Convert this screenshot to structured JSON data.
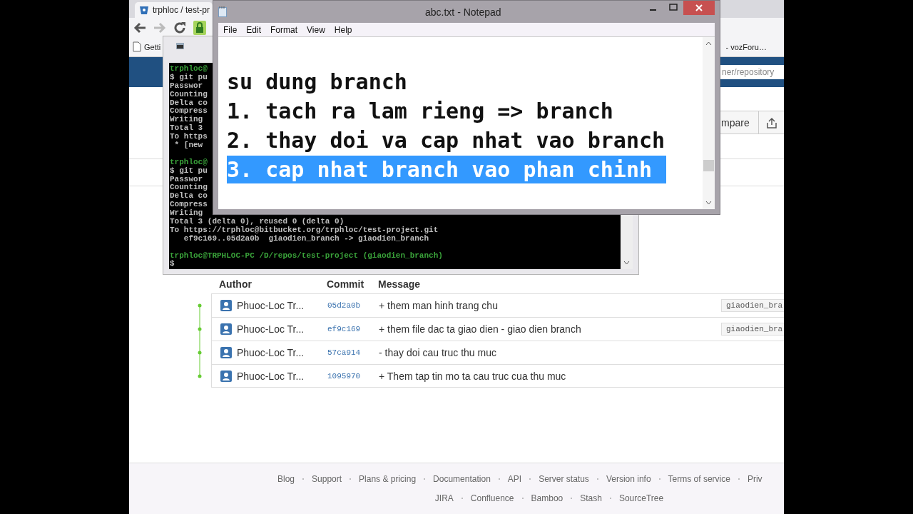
{
  "browser": {
    "tab": {
      "title": "trphloc / test-pr"
    },
    "bookmarks": [
      {
        "label": "Getti",
        "kind": "page"
      },
      {
        "label": "- vozForu…",
        "kind": "plain"
      }
    ],
    "search": {
      "placeholder": "ner/repository"
    },
    "toolbar": {
      "compare_label": "mpare"
    },
    "commits": {
      "columns": [
        "Author",
        "Commit",
        "Message"
      ],
      "rows": [
        {
          "author": "Phuoc-Loc Tr...",
          "hash": "05d2a0b",
          "message": "+ them man hinh trang chu",
          "tag": "giaodien_bra"
        },
        {
          "author": "Phuoc-Loc Tr...",
          "hash": "ef9c169",
          "message": "+ them file dac ta giao dien - giao dien branch",
          "tag": "giaodien_bra"
        },
        {
          "author": "Phuoc-Loc Tr...",
          "hash": "57ca914",
          "message": "- thay doi cau truc thu muc"
        },
        {
          "author": "Phuoc-Loc Tr...",
          "hash": "1095970",
          "message": "+ Them tap tin mo ta cau truc cua thu muc"
        }
      ]
    },
    "footer": {
      "links": [
        "Blog",
        "Support",
        "Plans & pricing",
        "Documentation",
        "API",
        "Server status",
        "Version info",
        "Terms of service",
        "Priv"
      ],
      "products": [
        "JIRA",
        "Confluence",
        "Bamboo",
        "Stash",
        "SourceTree"
      ]
    }
  },
  "terminal": {
    "blocks": [
      [
        {
          "text": "trphloc@",
          "kind": "prompt"
        },
        {
          "text": "$ git pu",
          "kind": "output"
        },
        {
          "text": "Passwor",
          "kind": "output"
        },
        {
          "text": "Counting",
          "kind": "output"
        },
        {
          "text": "Delta co",
          "kind": "output"
        },
        {
          "text": "Compress",
          "kind": "output"
        },
        {
          "text": "Writing",
          "kind": "output"
        },
        {
          "text": "Total 3",
          "kind": "output"
        },
        {
          "text": "To https",
          "kind": "output"
        },
        {
          "text": " * [new",
          "kind": "output"
        }
      ],
      [
        {
          "text": "trphloc@",
          "kind": "prompt"
        },
        {
          "text": "$ git pu",
          "kind": "output"
        },
        {
          "text": "Passwor",
          "kind": "output"
        },
        {
          "text": "Counting",
          "kind": "output"
        },
        {
          "text": "Delta co",
          "kind": "output"
        },
        {
          "text": "Compress",
          "kind": "output"
        },
        {
          "text": "Writing",
          "kind": "output"
        },
        {
          "text": "Total 3 (delta 0), reused 0 (delta 0)",
          "kind": "output"
        },
        {
          "text": "To https://trphloc@bitbucket.org/trphloc/test-project.git",
          "kind": "output"
        },
        {
          "text": "   ef9c169..05d2a0b  giaodien_branch -> giaodien_branch",
          "kind": "output"
        }
      ],
      [
        {
          "text": "trphloc@TRPHLOC-PC /D/repos/test-project (giaodien_branch)",
          "kind": "prompt"
        },
        {
          "text": "$",
          "kind": "output"
        }
      ]
    ]
  },
  "notepad": {
    "title": "abc.txt - Notepad",
    "menu": [
      "File",
      "Edit",
      "Format",
      "View",
      "Help"
    ],
    "lines": [
      {
        "text": "su dung branch",
        "selected": false
      },
      {
        "text": "1. tach ra lam rieng => branch",
        "selected": false
      },
      {
        "text": "2. thay doi va cap nhat vao branch",
        "selected": false
      },
      {
        "text": "3. cap nhat branch vao phan chinh",
        "selected": true
      }
    ]
  }
}
